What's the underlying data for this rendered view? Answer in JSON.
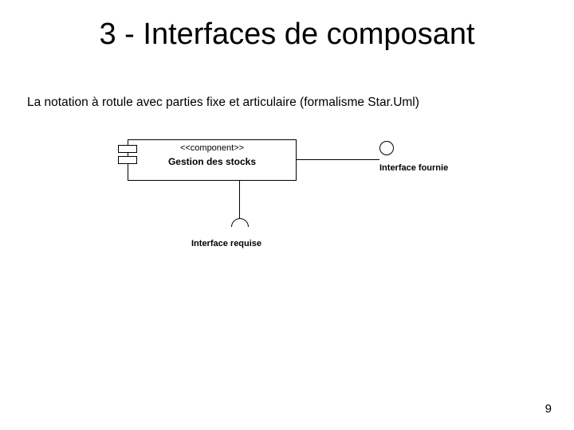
{
  "title": "3 - Interfaces de composant",
  "subtitle": "La notation à rotule avec parties fixe et articulaire (formalisme Star.Uml)",
  "component": {
    "stereotype": "<<component>>",
    "name": "Gestion des stocks"
  },
  "provided_interface_label": "Interface fournie",
  "required_interface_label": "Interface requise",
  "page_number": "9"
}
